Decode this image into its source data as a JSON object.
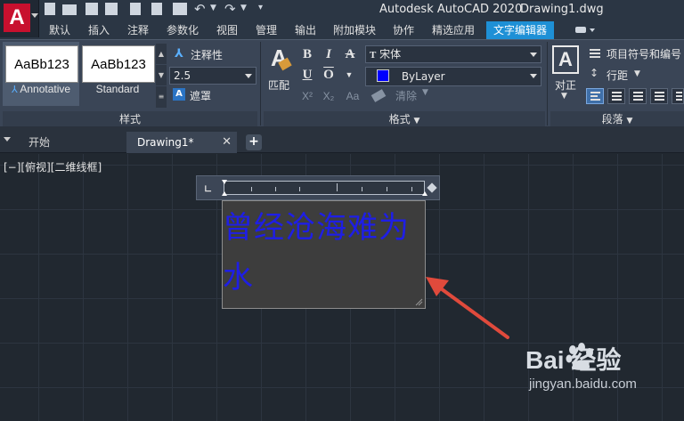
{
  "window": {
    "app_logo": "A",
    "product": "Autodesk AutoCAD 2020",
    "filename": "Drawing1.dwg"
  },
  "ribbon_tabs": [
    {
      "label": "默认",
      "active": false
    },
    {
      "label": "插入",
      "active": false
    },
    {
      "label": "注释",
      "active": false
    },
    {
      "label": "参数化",
      "active": false
    },
    {
      "label": "视图",
      "active": false
    },
    {
      "label": "管理",
      "active": false
    },
    {
      "label": "输出",
      "active": false
    },
    {
      "label": "附加模块",
      "active": false
    },
    {
      "label": "协作",
      "active": false
    },
    {
      "label": "精选应用",
      "active": false
    },
    {
      "label": "文字编辑器",
      "active": true
    }
  ],
  "style_panel": {
    "title": "样式",
    "styles": [
      {
        "preview": "AaBb123",
        "name": "Annotative",
        "selected": true
      },
      {
        "preview": "AaBb123",
        "name": "Standard",
        "selected": false
      }
    ],
    "annotative_label": "注释性",
    "text_height": "2.5",
    "mask_label": "遮罩"
  },
  "format_panel": {
    "title": "格式",
    "match_label": "匹配",
    "bold": "B",
    "italic": "I",
    "strike": "A",
    "underline": "U",
    "overline": "O",
    "superscript": "X²",
    "subscript": "X₂",
    "case": "Aa",
    "clear_label": "清除",
    "font": "宋体",
    "color": "ByLayer",
    "color_swatch": "#0000ff"
  },
  "paragraph_panel": {
    "title": "段落",
    "justify_label": "对正",
    "bullets_label": "项目符号和编号",
    "line_spacing_label": "行距"
  },
  "file_tabs": [
    {
      "label": "开始",
      "active": false
    },
    {
      "label": "Drawing1*",
      "active": true
    }
  ],
  "add_tab_icon": "+",
  "close_icon": "✕",
  "viewport_label": "[−][俯视][二维线框]",
  "mtext_content": "曾经沧海难为水",
  "annotation_arrow_color": "#e04a3c",
  "watermark": {
    "top": "Bai 经验",
    "bottom": "jingyan.baidu.com"
  }
}
